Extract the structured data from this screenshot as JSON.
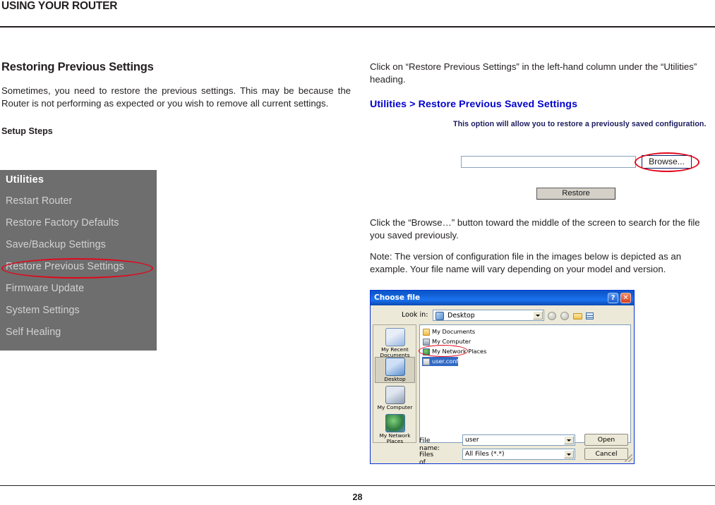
{
  "header": {
    "title": "USING YOUR ROUTER"
  },
  "left_column": {
    "section_title": "Restoring Previous Settings",
    "intro": "Sometimes, you need to restore the previous settings. This may be because the Router is not performing as expected or you wish to remove all current settings.",
    "sub_title": "Setup Steps"
  },
  "router_menu": {
    "heading": "Utilities",
    "items": [
      "Restart Router",
      "Restore Factory Defaults",
      "Save/Backup Settings",
      "Restore Previous Settings",
      "Firmware Update",
      "System Settings",
      "Self Healing"
    ],
    "highlighted_item": "Restore Previous Settings",
    "background_color": "#6e6e6e",
    "text_color": "#d2d2d2",
    "heading_color": "#ffffff",
    "highlight_color": "#e2071c"
  },
  "right_column": {
    "paragraph_1": "Click on “Restore Previous Settings” in the left-hand column under the “Utilities” heading.",
    "paragraph_2": "Click the “Browse…” button toward the middle of the screen to search for the file you saved previously.",
    "paragraph_3": "Note: The version of configuration file in the images below is depicted as an example. Your file name will vary depending on your model and version."
  },
  "router_ui": {
    "heading": "Utilities > Restore Previous Saved Settings",
    "heading_color": "#0000cc",
    "description": "This option will allow you to restore a previously saved configuration.",
    "file_field_value": "",
    "browse_label": "Browse...",
    "restore_label": "Restore"
  },
  "choose_file_dialog": {
    "title": "Choose file",
    "help_button": "?",
    "close_button": "✕",
    "lookin_label": "Look in:",
    "lookin_value": "Desktop",
    "toolbar_icons": [
      "back-icon",
      "up-one-level-icon",
      "new-folder-icon",
      "views-icon"
    ],
    "places": [
      "My Recent Documents",
      "Desktop",
      "My Computer",
      "My Network Places"
    ],
    "selected_place": "Desktop",
    "files": [
      {
        "name": "My Documents",
        "icon": "folder-icon",
        "selected": false
      },
      {
        "name": "My Computer",
        "icon": "computer-icon",
        "selected": false
      },
      {
        "name": "My Network Places",
        "icon": "network-icon",
        "selected": false
      },
      {
        "name": "user.conf",
        "icon": "file-icon",
        "selected": true
      }
    ],
    "filename_label": "File name:",
    "filename_value": "user",
    "filetype_label": "Files of type:",
    "filetype_value": "All Files (*.*)",
    "open_label": "Open",
    "cancel_label": "Cancel",
    "titlebar_color": "#0a5fd4"
  },
  "footer": {
    "page_number": "28"
  }
}
